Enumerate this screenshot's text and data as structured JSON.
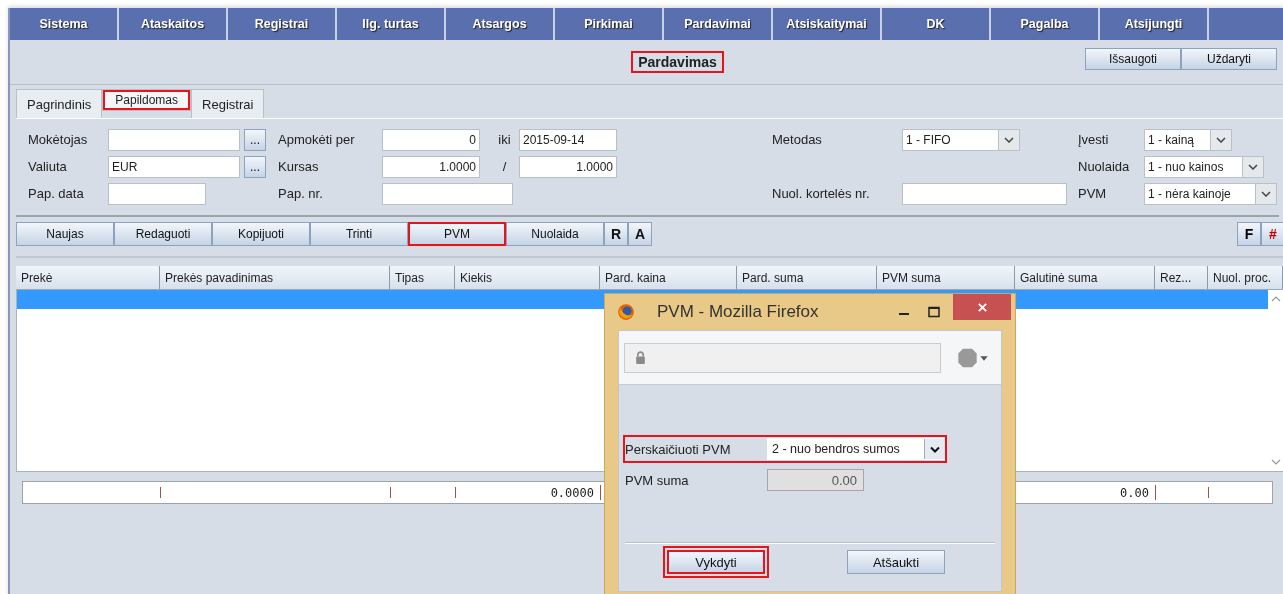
{
  "menu": [
    {
      "label": "Sistema"
    },
    {
      "label": "Ataskaitos"
    },
    {
      "label": "Registrai"
    },
    {
      "label": "Ilg. turtas"
    },
    {
      "label": "Atsargos"
    },
    {
      "label": "Pirkimai"
    },
    {
      "label": "Pardavimai"
    },
    {
      "label": "Atsiskaitymai"
    },
    {
      "label": "DK"
    },
    {
      "label": "Pagalba"
    },
    {
      "label": "Atsijungti"
    }
  ],
  "title": {
    "text": "Pardavimas",
    "highlighted": true
  },
  "header_buttons": [
    {
      "label": "Išsaugoti"
    },
    {
      "label": "Uždaryti"
    }
  ],
  "tabs": [
    {
      "label": "Pagrindinis",
      "selected": false,
      "highlighted": false
    },
    {
      "label": "Papildomas",
      "selected": true,
      "highlighted": true
    },
    {
      "label": "Registrai",
      "selected": false,
      "highlighted": false
    }
  ],
  "form": {
    "moketojas": {
      "label": "Mokėtojas",
      "browse": "..."
    },
    "valiuta": {
      "label": "Valiuta",
      "value": "EUR",
      "browse": "..."
    },
    "pap_data": {
      "label": "Pap. data"
    },
    "apmoketi_per": {
      "label": "Apmokėti per",
      "value": "0"
    },
    "iki": {
      "label": "iki",
      "value": "2015-09-14"
    },
    "kursas": {
      "label": "Kursas",
      "value": "1.0000"
    },
    "kursas_separator": "/",
    "kursas_2": {
      "value": "1.0000"
    },
    "pap_nr": {
      "label": "Pap. nr."
    },
    "metodas": {
      "label": "Metodas",
      "value": "1 - FIFO"
    },
    "kortele": {
      "label": "Nuol. kortelės nr."
    },
    "ivesti": {
      "label": "Įvesti",
      "value": "1 - kainą"
    },
    "nuolaida": {
      "label": "Nuolaida",
      "value": "1 - nuo kainos"
    },
    "pvm": {
      "label": "PVM",
      "value": "1 - nėra kainoje"
    }
  },
  "toolbar": [
    {
      "label": "Naujas",
      "highlighted": false
    },
    {
      "label": "Redaguoti",
      "highlighted": false
    },
    {
      "label": "Kopijuoti",
      "highlighted": false
    },
    {
      "label": "Trinti",
      "highlighted": false
    },
    {
      "label": "PVM",
      "highlighted": true
    },
    {
      "label": "Nuolaida",
      "highlighted": false
    },
    {
      "label": "R",
      "highlighted": false
    },
    {
      "label": "A",
      "highlighted": false
    }
  ],
  "toolbar_right": [
    {
      "label": "F",
      "color": "#000000"
    },
    {
      "label": "#",
      "color": "#cc0000"
    }
  ],
  "table": {
    "columns": [
      "Prekė",
      "Prekės pavadinimas",
      "Tipas",
      "Kiekis",
      "Pard. kaina",
      "Pard. suma",
      "PVM suma",
      "Galutinė suma",
      "Rez...",
      "Nuol. proc."
    ],
    "rows": [
      {
        "selected": true
      }
    ],
    "totals": {
      "kiekis": "0.0000",
      "galutine_suma": "0.00"
    }
  },
  "dialog": {
    "title": "PVM - Mozilla Firefox",
    "fields": [
      {
        "kind": "select",
        "label": "Perskaičiuoti PVM",
        "value": "2 - nuo bendros sumos",
        "highlighted": true
      },
      {
        "kind": "readonly",
        "label": "PVM suma",
        "value": "0.00",
        "highlighted": false
      }
    ],
    "buttons": [
      {
        "label": "Vykdyti",
        "highlighted": true
      },
      {
        "label": "Atšaukti",
        "highlighted": false
      }
    ]
  }
}
